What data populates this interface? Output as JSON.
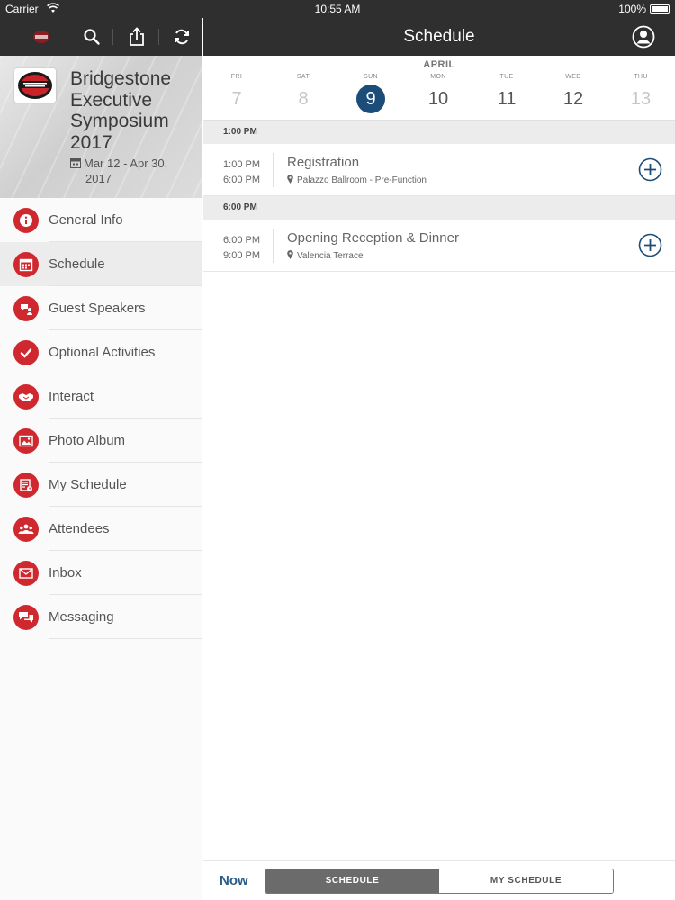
{
  "status_bar": {
    "carrier": "Carrier",
    "time": "10:55 AM",
    "battery": "100%"
  },
  "sidebar": {
    "event": {
      "title": "Bridgestone Executive Symposium 2017",
      "dates_line1": "Mar 12 - Apr 30,",
      "dates_line2": "2017",
      "logo_text": "CHOOSE TO WIN"
    },
    "items": [
      {
        "label": "General Info",
        "icon": "info-icon"
      },
      {
        "label": "Schedule",
        "icon": "calendar-icon",
        "active": true
      },
      {
        "label": "Guest Speakers",
        "icon": "speaker-icon"
      },
      {
        "label": "Optional Activities",
        "icon": "check-icon"
      },
      {
        "label": "Interact",
        "icon": "handshake-icon"
      },
      {
        "label": "Photo Album",
        "icon": "photo-icon"
      },
      {
        "label": "My Schedule",
        "icon": "my-schedule-icon"
      },
      {
        "label": "Attendees",
        "icon": "people-icon"
      },
      {
        "label": "Inbox",
        "icon": "envelope-icon"
      },
      {
        "label": "Messaging",
        "icon": "chat-icon"
      }
    ]
  },
  "header": {
    "title": "Schedule"
  },
  "datebar": {
    "month": "APRIL",
    "days": [
      {
        "dow": "FRI",
        "num": "7"
      },
      {
        "dow": "SAT",
        "num": "8"
      },
      {
        "dow": "SUN",
        "num": "9"
      },
      {
        "dow": "MON",
        "num": "10"
      },
      {
        "dow": "TUE",
        "num": "11"
      },
      {
        "dow": "WED",
        "num": "12"
      },
      {
        "dow": "THU",
        "num": "13"
      }
    ],
    "selected_index": 2
  },
  "sections": [
    {
      "header": "1:00 PM",
      "session": {
        "start": "1:00 PM",
        "end": "6:00 PM",
        "title": "Registration",
        "location": "Palazzo Ballroom - Pre-Function"
      }
    },
    {
      "header": "6:00 PM",
      "session": {
        "start": "6:00 PM",
        "end": "9:00 PM",
        "title": "Opening Reception & Dinner",
        "location": "Valencia Terrace"
      }
    }
  ],
  "bottom": {
    "now": "Now",
    "tab_schedule": "SCHEDULE",
    "tab_my_schedule": "MY SCHEDULE"
  },
  "colors": {
    "accent_red": "#d0282f",
    "selected_navy": "#1c4c78",
    "toolbar": "#2f2f2f"
  }
}
